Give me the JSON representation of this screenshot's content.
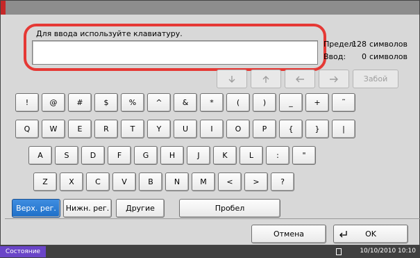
{
  "screen": {
    "prompt": "Для ввода используйте клавиатуру.",
    "input_value": "",
    "limit_label": "Предел:",
    "limit_value": "128",
    "limit_unit": "символов",
    "input_label": "Ввод:",
    "input_count": "0",
    "input_unit": "символов"
  },
  "nav": {
    "down_icon": "arrow-down-icon",
    "up_icon": "arrow-up-icon",
    "left_icon": "arrow-left-icon",
    "right_icon": "arrow-right-icon",
    "backspace": "Забой"
  },
  "keyboard": {
    "row1": [
      "!",
      "@",
      "#",
      "$",
      "%",
      "^",
      "&",
      "*",
      "(",
      ")",
      "_",
      "+",
      "˜"
    ],
    "row2": [
      "Q",
      "W",
      "E",
      "R",
      "T",
      "Y",
      "U",
      "I",
      "O",
      "P",
      "{",
      "}",
      "|"
    ],
    "row3": [
      "A",
      "S",
      "D",
      "F",
      "G",
      "H",
      "J",
      "K",
      "L",
      ":",
      "\""
    ],
    "row4": [
      "Z",
      "X",
      "C",
      "V",
      "B",
      "N",
      "M",
      "<",
      ">",
      "?"
    ]
  },
  "modes": {
    "upper": "Верх. рег.",
    "lower": "Нижн. рег.",
    "other": "Другие",
    "space": "Пробел"
  },
  "actions": {
    "cancel": "Отмена",
    "ok": "OK",
    "enter_icon": "enter-return-icon"
  },
  "status": {
    "label": "Состояние",
    "time": "10/10/2010  10:10"
  },
  "colors": {
    "highlight": "#e53935",
    "selected_mode": "#1e6fc8",
    "status_label_bg": "#6a45c8"
  }
}
